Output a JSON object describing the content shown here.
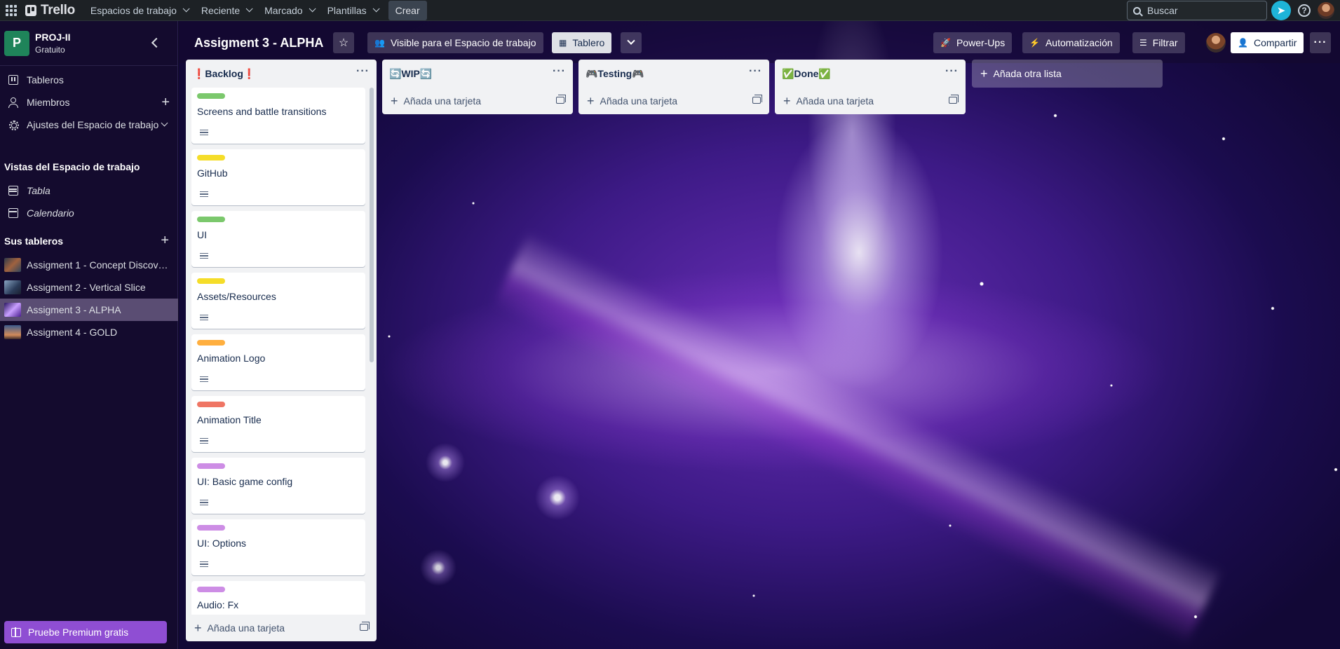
{
  "topnav": {
    "brand": "Trello",
    "menus": [
      {
        "label": "Espacios de trabajo"
      },
      {
        "label": "Reciente"
      },
      {
        "label": "Marcado"
      },
      {
        "label": "Plantillas"
      }
    ],
    "create_label": "Crear",
    "search_placeholder": "Buscar"
  },
  "sidebar": {
    "workspace_initial": "P",
    "workspace_name": "PROJ-II",
    "workspace_plan": "Gratuito",
    "items": [
      {
        "label": "Tableros"
      },
      {
        "label": "Miembros"
      },
      {
        "label": "Ajustes del Espacio de trabajo"
      }
    ],
    "views_heading": "Vistas del Espacio de trabajo",
    "views": [
      {
        "label": "Tabla"
      },
      {
        "label": "Calendario"
      }
    ],
    "boards_heading": "Sus tableros",
    "boards": [
      {
        "label": "Assigment 1 - Concept Discove..."
      },
      {
        "label": "Assigment 2 - Vertical Slice"
      },
      {
        "label": "Assigment 3 - ALPHA"
      },
      {
        "label": "Assigment 4 - GOLD"
      }
    ],
    "premium_label": "Pruebe Premium gratis"
  },
  "board_header": {
    "title": "Assigment 3 - ALPHA",
    "visibility_label": "Visible para el Espacio de trabajo",
    "view_label": "Tablero",
    "powerups_label": "Power-Ups",
    "automation_label": "Automatización",
    "filter_label": "Filtrar",
    "share_label": "Compartir"
  },
  "lists": [
    {
      "title": "❗Backlog❗",
      "add_card_label": "Añada una tarjeta",
      "cards": [
        {
          "title": "Screens and battle transitions",
          "label_color": "#7bc86c"
        },
        {
          "title": "GitHub",
          "label_color": "#f5dd29"
        },
        {
          "title": "UI",
          "label_color": "#7bc86c"
        },
        {
          "title": "Assets/Resources",
          "label_color": "#f5dd29"
        },
        {
          "title": "Animation Logo",
          "label_color": "#ffaf3f"
        },
        {
          "title": "Animation Title",
          "label_color": "#ef7564"
        },
        {
          "title": "UI: Basic game config",
          "label_color": "#cd8de5"
        },
        {
          "title": "UI: Options",
          "label_color": "#cd8de5"
        },
        {
          "title": "Audio: Fx",
          "label_color": "#cd8de5"
        }
      ]
    },
    {
      "title": "🔄WIP🔄",
      "add_card_label": "Añada una tarjeta",
      "cards": []
    },
    {
      "title": "🎮Testing🎮",
      "add_card_label": "Añada una tarjeta",
      "cards": []
    },
    {
      "title": "✅Done✅",
      "add_card_label": "Añada una tarjeta",
      "cards": []
    }
  ],
  "add_list_label": "Añada otra lista"
}
